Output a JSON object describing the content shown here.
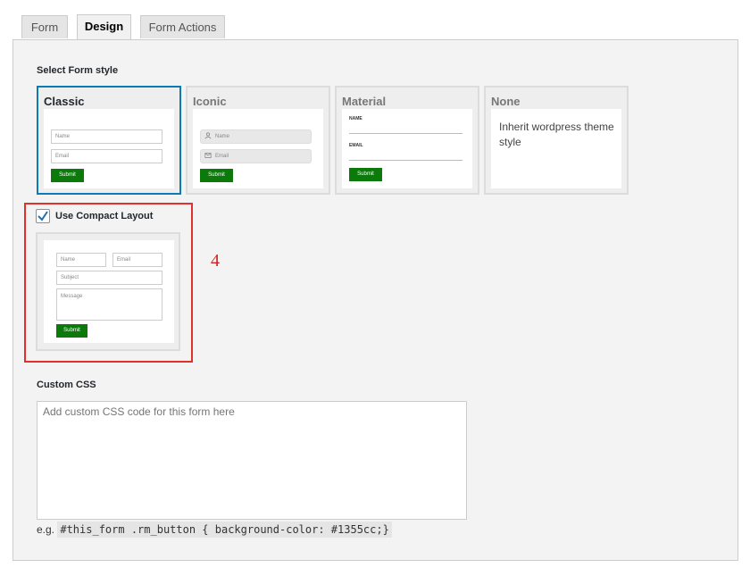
{
  "tabs": [
    {
      "label": "Form"
    },
    {
      "label": "Design"
    },
    {
      "label": "Form Actions"
    }
  ],
  "active_tab": "Design",
  "form_style": {
    "heading": "Select Form style",
    "options": [
      {
        "title": "Classic",
        "selected": true,
        "fields": [
          "Name",
          "Email"
        ],
        "button": "Submit"
      },
      {
        "title": "Iconic",
        "selected": false,
        "fields": [
          "Name",
          "Email"
        ],
        "button": "Submit"
      },
      {
        "title": "Material",
        "selected": false,
        "fields": [
          "NAME",
          "EMAIL"
        ],
        "button": "Submit"
      },
      {
        "title": "None",
        "selected": false,
        "description": "Inherit wordpress theme style"
      }
    ]
  },
  "compact_layout": {
    "label": "Use Compact Layout",
    "checked": true,
    "preview": {
      "name": "Name",
      "email": "Email",
      "subject": "Subject",
      "message": "Message",
      "button": "Submit"
    }
  },
  "annotation": "4",
  "custom_css": {
    "heading": "Custom CSS",
    "placeholder": "Add custom CSS code for this form here",
    "hint_prefix": "e.g.",
    "hint_code": "#this_form .rm_button { background-color: #1355cc;}"
  },
  "colors": {
    "accent": "#0a7bb6",
    "button_green": "#0b7a0b",
    "annotation_red": "#e0322a"
  }
}
